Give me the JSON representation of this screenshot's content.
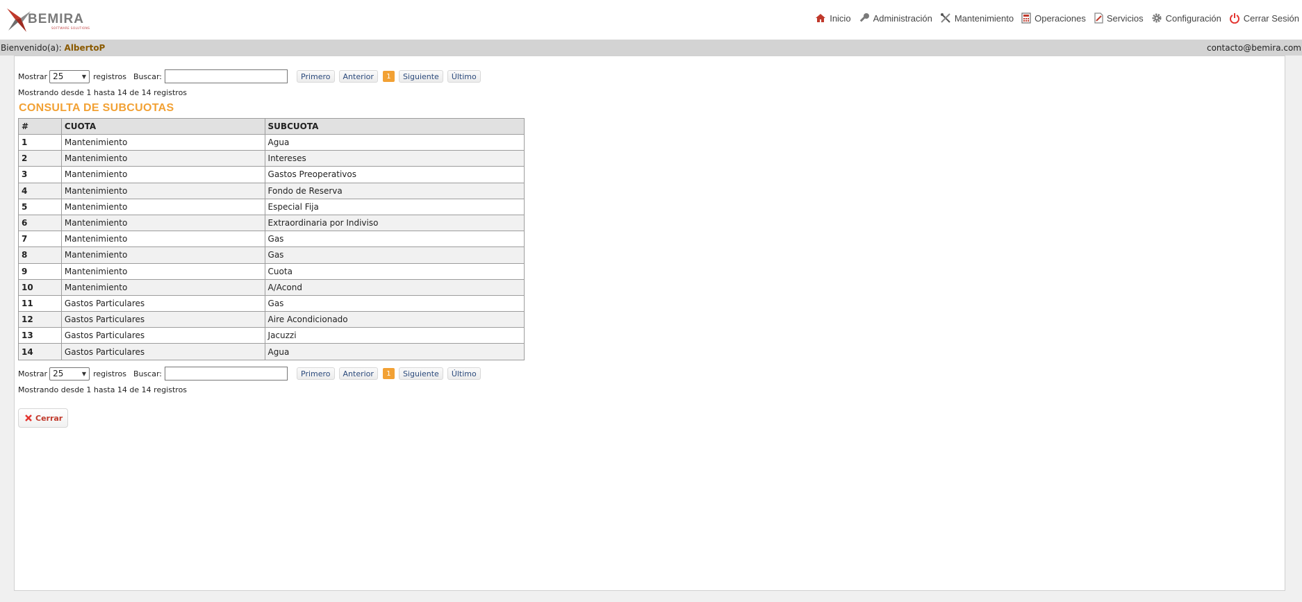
{
  "brand": {
    "name": "BEMIRA",
    "tagline": "SOFTWARE SOLUTIONS"
  },
  "nav": {
    "items": [
      {
        "label": "Inicio",
        "icon": "home-icon"
      },
      {
        "label": "Administración",
        "icon": "key-icon"
      },
      {
        "label": "Mantenimiento",
        "icon": "tools-icon"
      },
      {
        "label": "Operaciones",
        "icon": "calculator-icon"
      },
      {
        "label": "Servicios",
        "icon": "document-icon"
      },
      {
        "label": "Configuración",
        "icon": "gear-icon"
      },
      {
        "label": "Cerrar Sesión",
        "icon": "power-icon"
      }
    ]
  },
  "welcome": {
    "prefix": "Bienvenido(a):",
    "user": "AlbertoP",
    "email": "contacto@bemira.com"
  },
  "controls": {
    "show_label": "Mostrar",
    "show_value": "25",
    "records_label": "registros",
    "search_label": "Buscar:",
    "search_value": "",
    "first": "Primero",
    "prev": "Anterior",
    "current_page": "1",
    "next": "Siguiente",
    "last": "Último",
    "info": "Mostrando desde 1 hasta 14 de 14 registros"
  },
  "title": "CONSULTA DE SUBCUOTAS",
  "table": {
    "headers": [
      "#",
      "CUOTA",
      "SUBCUOTA"
    ],
    "rows": [
      [
        "1",
        "Mantenimiento",
        "Agua"
      ],
      [
        "2",
        "Mantenimiento",
        "Intereses"
      ],
      [
        "3",
        "Mantenimiento",
        "Gastos Preoperativos"
      ],
      [
        "4",
        "Mantenimiento",
        "Fondo de Reserva"
      ],
      [
        "5",
        "Mantenimiento",
        "Especial Fija"
      ],
      [
        "6",
        "Mantenimiento",
        "Extraordinaria por Indiviso"
      ],
      [
        "7",
        "Mantenimiento",
        "Gas"
      ],
      [
        "8",
        "Mantenimiento",
        "Gas"
      ],
      [
        "9",
        "Mantenimiento",
        "Cuota"
      ],
      [
        "10",
        "Mantenimiento",
        "A/Acond"
      ],
      [
        "11",
        "Gastos Particulares",
        "Gas"
      ],
      [
        "12",
        "Gastos Particulares",
        "Aire Acondicionado"
      ],
      [
        "13",
        "Gastos Particulares",
        "Jacuzzi"
      ],
      [
        "14",
        "Gastos Particulares",
        "Agua"
      ]
    ]
  },
  "close_button": {
    "label": "Cerrar",
    "icon": "close-icon"
  },
  "colors": {
    "accent": "#f2a134",
    "close": "#c0392b",
    "welcome_bar": "#d3d3d3"
  }
}
